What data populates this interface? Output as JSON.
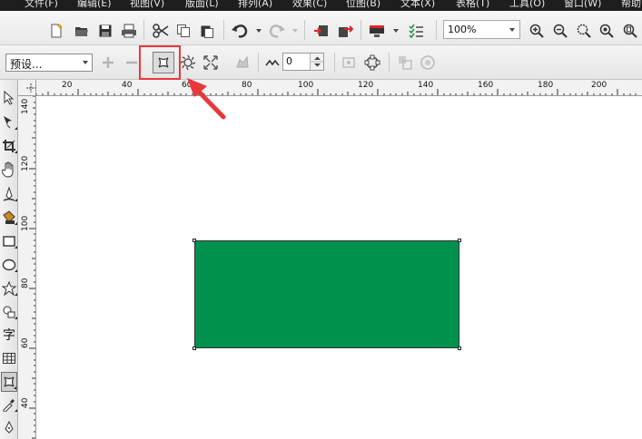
{
  "menu": [
    "文件(F)",
    "编辑(E)",
    "视图(V)",
    "版面(L)",
    "排列(A)",
    "效果(C)",
    "位图(B)",
    "文本(X)",
    "表格(T)",
    "工具(O)",
    "窗口(W)",
    "帮助"
  ],
  "toolbar": {
    "zoom_value": "100%"
  },
  "property_bar": {
    "preset_value": "预设...",
    "amount_value": "0"
  },
  "ruler_top": {
    "labels": [
      "20",
      "40",
      "60",
      "80",
      "100",
      "120",
      "140",
      "160",
      "180",
      "200"
    ]
  },
  "ruler_left": {
    "labels": [
      "140",
      "120",
      "100",
      "80",
      "60",
      "40"
    ]
  },
  "toolbox": {
    "text_tool_glyph": "字"
  },
  "colors": {
    "shape_fill": "#00914d",
    "highlight": "#e8383b",
    "menubar_bg": "#1e1e1e"
  }
}
